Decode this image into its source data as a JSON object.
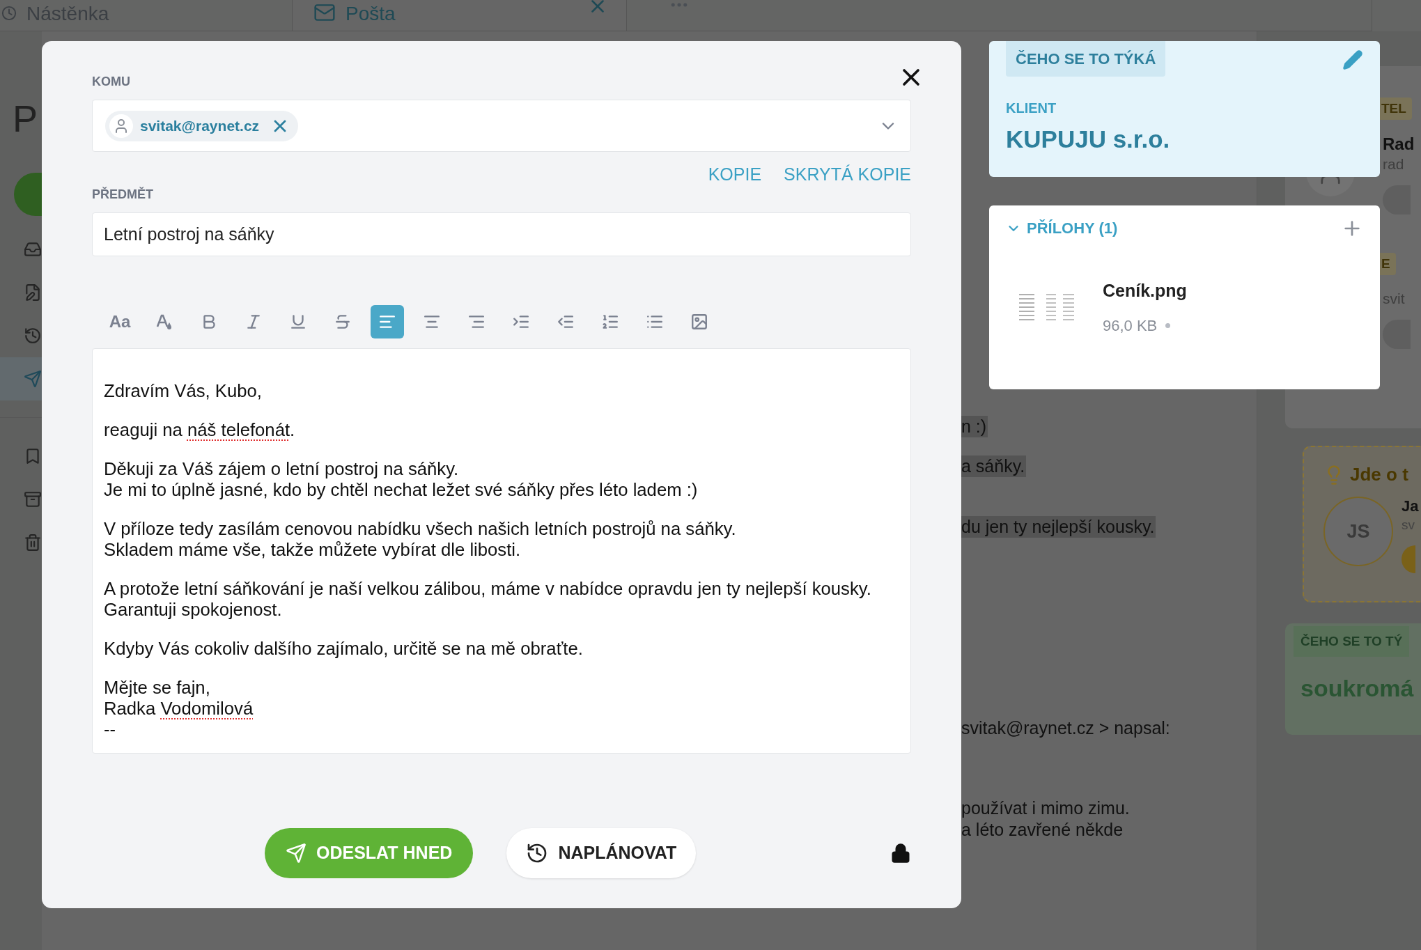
{
  "background": {
    "tabs": [
      {
        "label": "Nástěnka",
        "selected": false
      },
      {
        "label": "Pošta",
        "selected": true
      }
    ],
    "sidebar": {
      "title": "P",
      "items": [
        {
          "kind": "inbox",
          "selected": false
        },
        {
          "kind": "draft",
          "selected": false
        },
        {
          "kind": "scheduled",
          "selected": false
        },
        {
          "kind": "sent",
          "selected": true
        },
        {
          "kind": "saved",
          "selected": false
        },
        {
          "kind": "archive",
          "selected": false
        },
        {
          "kind": "trash",
          "selected": false
        }
      ]
    },
    "email_fragments": [
      {
        "text": "n :)",
        "highlighted": true
      },
      {
        "text": "a sáňky.",
        "highlighted": true
      },
      {
        "text": "du jen ty nejlepší kousky.",
        "highlighted": true
      },
      {
        "text": "svitak@raynet.cz > napsal:",
        "highlighted": false
      },
      {
        "text": "používat i mimo zimu.",
        "highlighted": false
      },
      {
        "text": "a léto zavřené někde",
        "highlighted": false
      }
    ],
    "right_panel": {
      "contacts": [
        {
          "badge": "TEL",
          "name": "Rad",
          "detail": "rad"
        },
        {
          "badge": "E",
          "detail": "svit"
        }
      ],
      "suggestion": {
        "title": "Jde o t",
        "initials": "JS",
        "name": "Ja",
        "detail": "sv"
      },
      "relation": {
        "badge": "ČEHO SE TO TÝ",
        "value": "soukromá"
      }
    }
  },
  "composer": {
    "to_label": "KOMU",
    "recipients": [
      {
        "email": "svitak@raynet.cz"
      }
    ],
    "cc": "KOPIE",
    "bcc": "SKRYTÁ KOPIE",
    "subject_label": "PŘEDMĚT",
    "subject": "Letní postroj na sáňky",
    "toolbar": [
      {
        "kind": "font-size",
        "label": "Aa",
        "selected": false
      },
      {
        "kind": "font-color",
        "selected": false
      },
      {
        "kind": "bold",
        "selected": false
      },
      {
        "kind": "italic",
        "selected": false
      },
      {
        "kind": "underline",
        "selected": false
      },
      {
        "kind": "strikethrough",
        "selected": false
      },
      {
        "kind": "align-left",
        "selected": true
      },
      {
        "kind": "align-center",
        "selected": false
      },
      {
        "kind": "align-right",
        "selected": false
      },
      {
        "kind": "indent",
        "selected": false
      },
      {
        "kind": "outdent",
        "selected": false
      },
      {
        "kind": "numbered-list",
        "selected": false
      },
      {
        "kind": "bullet-list",
        "selected": false
      },
      {
        "kind": "image",
        "selected": false
      }
    ],
    "body": [
      [
        [
          {
            "text": "Zdravím Vás, Kubo,",
            "misspelled": false
          }
        ]
      ],
      [
        [
          {
            "text": "reaguji na ",
            "misspelled": false
          },
          {
            "text": "náš telefonát",
            "misspelled": true
          },
          {
            "text": ".",
            "misspelled": false
          }
        ]
      ],
      [
        [
          {
            "text": "Děkuji za Váš zájem o letní postroj na sáňky.",
            "misspelled": false
          }
        ],
        [
          {
            "text": "Je mi to úplně jasné, kdo by chtěl nechat ležet své sáňky přes léto ladem :)",
            "misspelled": false
          }
        ]
      ],
      [
        [
          {
            "text": "V příloze tedy zasílám cenovou nabídku všech našich letních postrojů na sáňky.",
            "misspelled": false
          }
        ],
        [
          {
            "text": "Skladem máme vše, takže můžete vybírat dle libosti.",
            "misspelled": false
          }
        ]
      ],
      [
        [
          {
            "text": "A protože letní sáňkování je naší velkou zálibou, máme v nabídce opravdu jen ty nejlepší kousky.",
            "misspelled": false
          }
        ],
        [
          {
            "text": "Garantuji spokojenost.",
            "misspelled": false
          }
        ]
      ],
      [
        [
          {
            "text": "Kdyby Vás cokoliv dalšího zajímalo, určitě se na mě obraťte.",
            "misspelled": false
          }
        ]
      ],
      [
        [
          {
            "text": "Mějte se fajn,",
            "misspelled": false
          }
        ],
        [
          {
            "text": "Radka ",
            "misspelled": false
          },
          {
            "text": "Vodomilová",
            "misspelled": true
          }
        ],
        [
          {
            "text": "--",
            "misspelled": false
          }
        ]
      ]
    ],
    "send": "ODESLAT HNED",
    "schedule": "NAPLÁNOVAT"
  },
  "related": {
    "badge": "ČEHO SE TO TÝKÁ",
    "type": "KLIENT",
    "name": "KUPUJU s.r.o."
  },
  "attachments": {
    "title": "PŘÍLOHY (1)",
    "expanded": true,
    "files": [
      {
        "name": "Ceník.png",
        "size": "96,0 KB"
      }
    ]
  }
}
